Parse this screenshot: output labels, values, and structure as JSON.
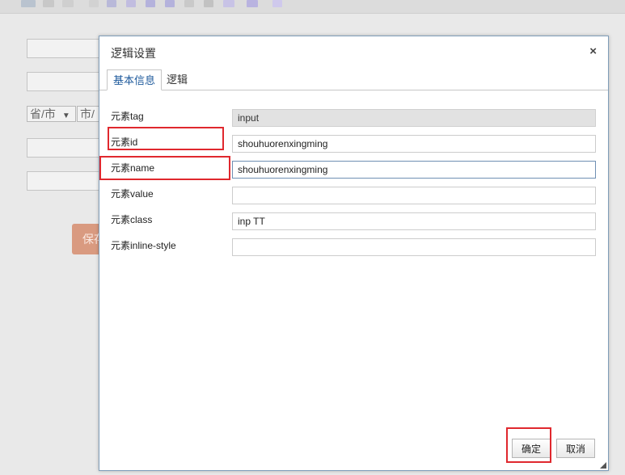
{
  "background": {
    "region_select": "省/市",
    "city_select": "市/",
    "save_button": "保存"
  },
  "dialog": {
    "title": "逻辑设置",
    "close_label": "×",
    "tabs": [
      {
        "label": "基本信息",
        "active": true
      },
      {
        "label": "逻辑",
        "active": false
      }
    ],
    "fields": [
      {
        "label": "元素tag",
        "value": "input",
        "readonly": true
      },
      {
        "label": "元素id",
        "value": "shouhuorenxingming",
        "readonly": false
      },
      {
        "label": "元素name",
        "value": "shouhuorenxingming",
        "readonly": false
      },
      {
        "label": "元素value",
        "value": "",
        "readonly": false
      },
      {
        "label": "元素class",
        "value": "inp TT",
        "readonly": false
      },
      {
        "label": "元素inline-style",
        "value": "",
        "readonly": false
      }
    ],
    "confirm_label": "确定",
    "cancel_label": "取消"
  },
  "colors": {
    "highlight": "#e0282e",
    "active_tab_text": "#1e5a9c",
    "dialog_border": "#7f9db9"
  }
}
